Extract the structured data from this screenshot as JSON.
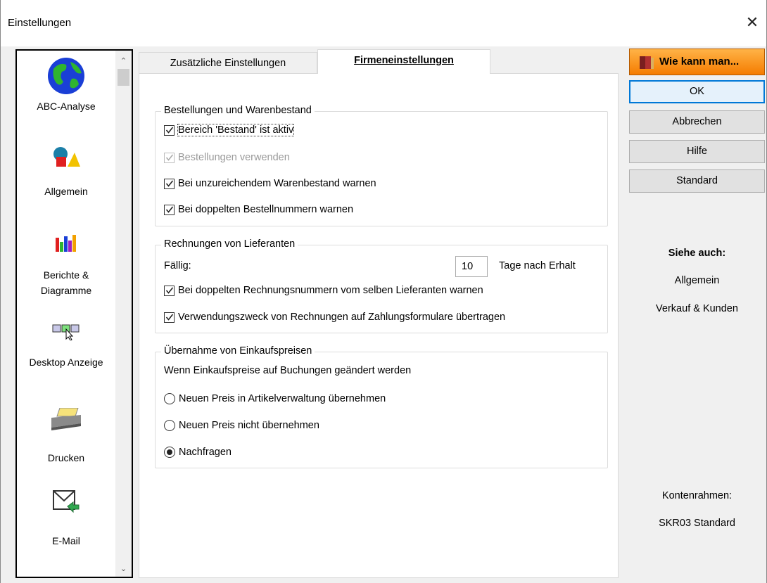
{
  "window": {
    "title": "Einstellungen"
  },
  "sidebar": {
    "items": [
      {
        "label": "ABC-Analyse"
      },
      {
        "label": "Allgemein"
      },
      {
        "label_line1": "Berichte &",
        "label_line2": "Diagramme"
      },
      {
        "label": "Desktop Anzeige"
      },
      {
        "label": "Drucken"
      },
      {
        "label": "E-Mail"
      }
    ]
  },
  "tabs": [
    {
      "label": "Zusätzliche Einstellungen"
    },
    {
      "label": "Firmeneinstellungen",
      "active": true
    }
  ],
  "groups": {
    "orders": {
      "legend": "Bestellungen und Warenbestand",
      "items": [
        {
          "label": "Bereich 'Bestand' ist aktiv",
          "checked": true
        },
        {
          "label": "Bestellungen verwenden",
          "checked": true,
          "disabled": true
        },
        {
          "label": "Bei unzureichendem Warenbestand warnen",
          "checked": true
        },
        {
          "label": "Bei doppelten Bestellnummern warnen",
          "checked": true
        }
      ]
    },
    "invoices": {
      "legend": "Rechnungen von Lieferanten",
      "due_label": "Fällig:",
      "due_value": "10",
      "due_suffix": "Tage nach Erhalt",
      "items": [
        {
          "label": "Bei doppelten Rechnungsnummern vom selben Lieferanten warnen",
          "checked": true
        },
        {
          "label": "Verwendungszweck von Rechnungen auf Zahlungsformulare übertragen",
          "checked": true
        }
      ]
    },
    "prices": {
      "legend": "Übernahme von Einkaufspreisen",
      "description": "Wenn Einkaufspreise auf Buchungen geändert werden",
      "options": [
        {
          "label": "Neuen Preis in Artikelverwaltung übernehmen",
          "selected": false
        },
        {
          "label": "Neuen Preis nicht übernehmen",
          "selected": false
        },
        {
          "label": "Nachfragen",
          "selected": true
        }
      ]
    }
  },
  "buttons": {
    "help": "Wie kann man...",
    "ok": "OK",
    "cancel": "Abbrechen",
    "hilfe": "Hilfe",
    "standard": "Standard"
  },
  "see_also": {
    "title": "Siehe auch:",
    "links": [
      "Allgemein",
      "Verkauf & Kunden"
    ]
  },
  "chart_of_accounts": {
    "label": "Kontenrahmen:",
    "value": "SKR03 Standard"
  },
  "colors": {
    "accent": "#0078d7",
    "help_button": "#f57c00"
  }
}
